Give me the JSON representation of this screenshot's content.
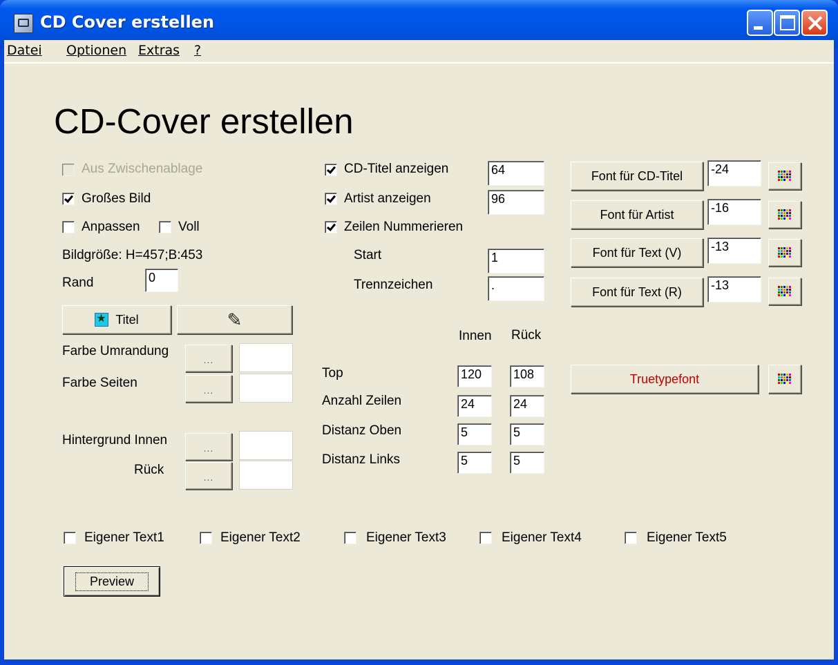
{
  "window": {
    "title": "CD Cover erstellen"
  },
  "menu": {
    "items": [
      "Datei",
      "Optionen",
      "Extras",
      "?"
    ]
  },
  "heading": "CD-Cover erstellen",
  "left": {
    "clipboard_label": "Aus Zwischenablage",
    "big_image_label": "Großes Bild",
    "fit_label": "Anpassen",
    "full_label": "Voll",
    "image_size": "Bildgröße: H=457;B:453",
    "margin_label": "Rand",
    "margin_value": "0",
    "title_button": "Titel",
    "border_color_label": "Farbe Umrandung",
    "side_color_label": "Farbe Seiten",
    "bg_inner_label": "Hintergrund Innen",
    "bg_back_label": "Rück",
    "dots": "..."
  },
  "middle": {
    "cd_title_label": "CD-Titel anzeigen",
    "cd_title_value": "64",
    "artist_label": "Artist anzeigen",
    "artist_value": "96",
    "number_rows_label": "Zeilen Nummerieren",
    "start_label": "Start",
    "start_value": "1",
    "separator_label": "Trennzeichen",
    "separator_value": ".",
    "col_inner": "Innen",
    "col_back": "Rück",
    "rows": [
      {
        "label": "Top",
        "inner": "120",
        "back": "108"
      },
      {
        "label": "Anzahl Zeilen",
        "inner": "24",
        "back": "24"
      },
      {
        "label": "Distanz Oben",
        "inner": "5",
        "back": "5"
      },
      {
        "label": "Distanz Links",
        "inner": "5",
        "back": "5"
      }
    ]
  },
  "right": {
    "fonts": [
      {
        "label": "Font für CD-Titel",
        "size": "-24"
      },
      {
        "label": "Font für Artist",
        "size": "-16"
      },
      {
        "label": "Font für Text (V)",
        "size": "-13"
      },
      {
        "label": "Font für Text (R)",
        "size": "-13"
      }
    ],
    "truetype_label": "Truetypefont",
    "truetype_color": "#c00000"
  },
  "custom_texts": [
    "Eigener Text1",
    "Eigener Text2",
    "Eigener Text3",
    "Eigener Text4",
    "Eigener Text5"
  ],
  "preview_label": "Preview",
  "icons": [
    "palette-grid-icon",
    "runner-icon",
    "eraser-icon"
  ]
}
